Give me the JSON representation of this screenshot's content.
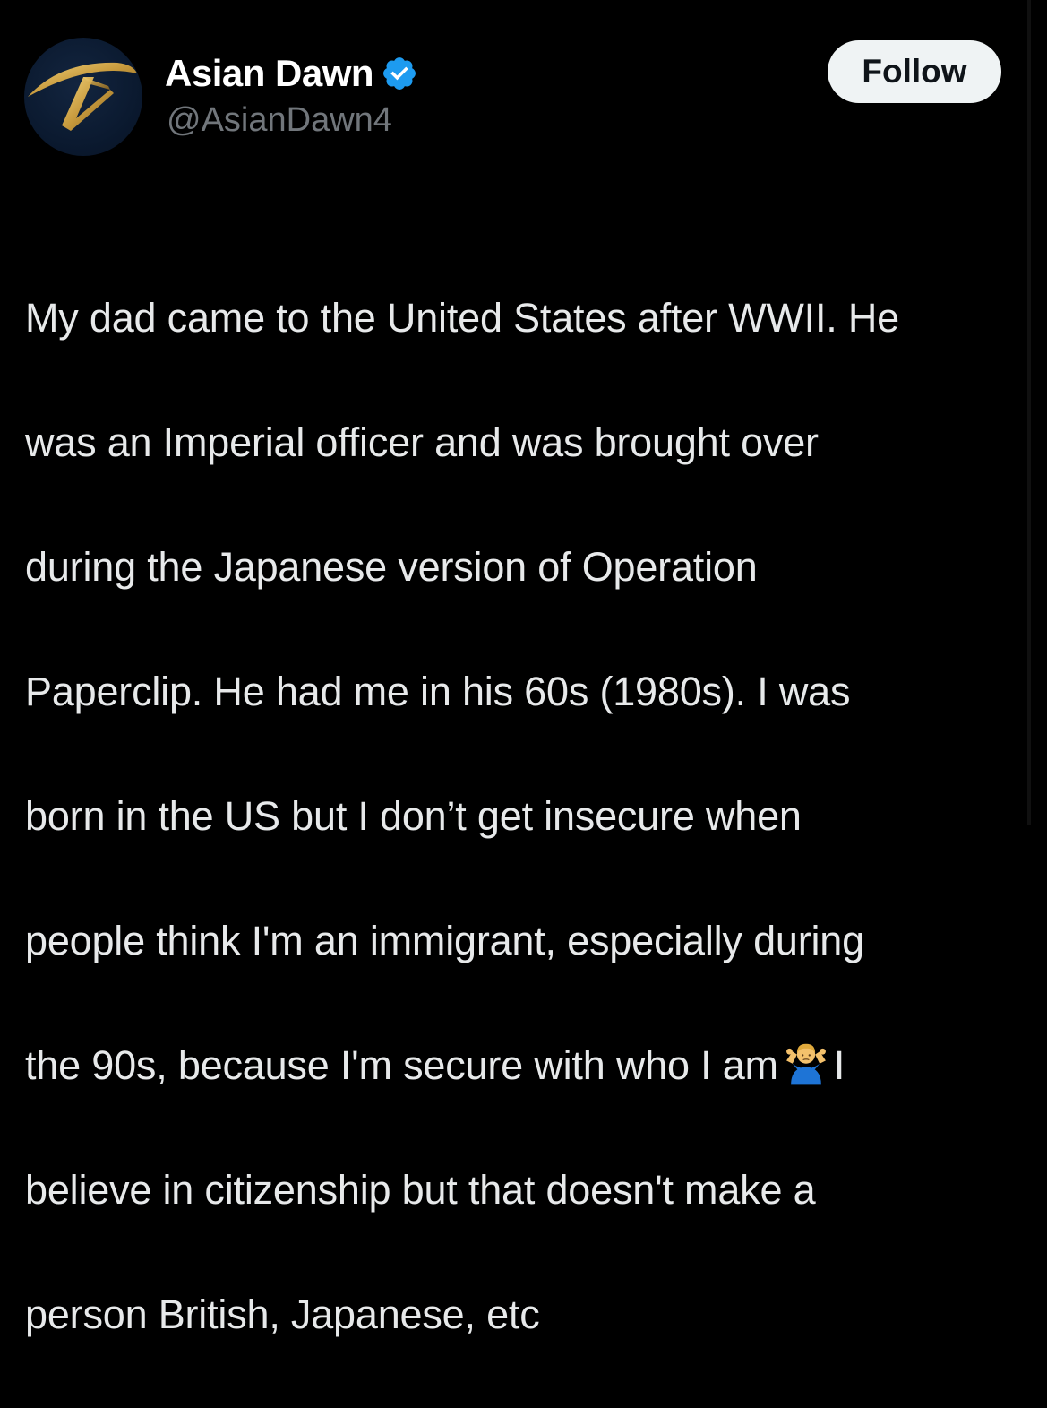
{
  "author": {
    "display_name": "Asian Dawn",
    "handle": "@AsianDawn4",
    "verified": true,
    "verified_icon": "verified-badge-icon",
    "avatar_icon": "asian-dawn-logo-icon"
  },
  "actions": {
    "follow_label": "Follow"
  },
  "tweet": {
    "lines": [
      "My dad came to the United States after WWII. He",
      "was an Imperial officer and was brought over",
      "during the Japanese version of Operation",
      "Paperclip. He had me in his 60s (1980s). I was",
      "born in the US but I don’t get insecure when",
      "people think I'm an immigrant, especially during",
      "the 90s, because I'm secure with who I am",
      "I",
      "believe in citizenship but that doesn't make a",
      "person British, Japanese, etc"
    ],
    "emoji": "person-shrugging-emoji"
  },
  "colors": {
    "background": "#000000",
    "text": "#e7e9ea",
    "secondary_text": "#71767b",
    "verified_blue": "#1d9bf0",
    "follow_button_bg": "#eff3f4",
    "follow_button_text": "#0f1419"
  }
}
